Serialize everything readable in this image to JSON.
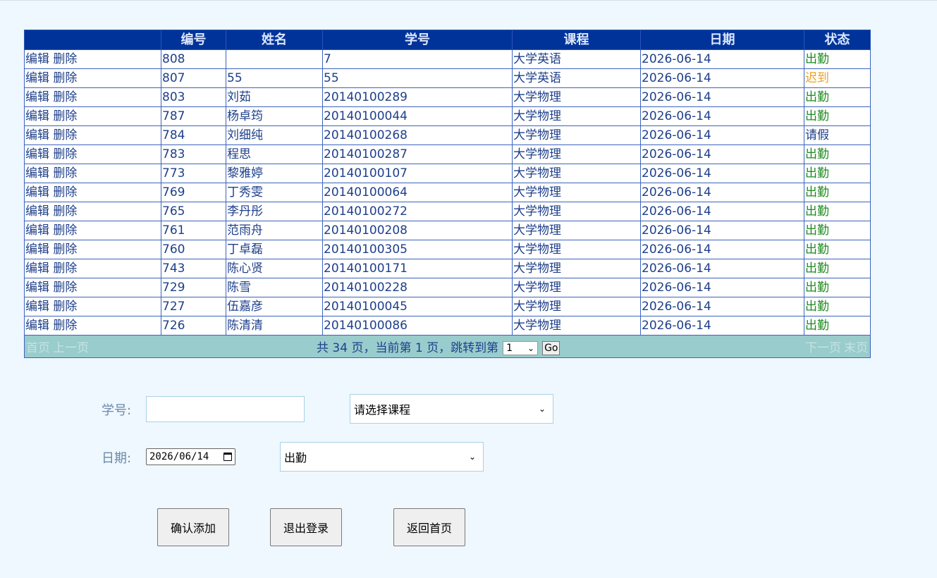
{
  "table": {
    "headers": [
      "",
      "编号",
      "姓名",
      "学号",
      "课程",
      "日期",
      "状态"
    ],
    "edit_label": "编辑",
    "delete_label": "删除",
    "rows": [
      {
        "id": "808",
        "name": "",
        "student_no": "7",
        "course": "大学英语",
        "date": "2026-06-14",
        "status": "出勤",
        "status_type": "ok"
      },
      {
        "id": "807",
        "name": "55",
        "student_no": "55",
        "course": "大学英语",
        "date": "2026-06-14",
        "status": "迟到",
        "status_type": "late"
      },
      {
        "id": "803",
        "name": "刘茹",
        "student_no": "20140100289",
        "course": "大学物理",
        "date": "2026-06-14",
        "status": "出勤",
        "status_type": "ok"
      },
      {
        "id": "787",
        "name": "杨卓筠",
        "student_no": "20140100044",
        "course": "大学物理",
        "date": "2026-06-14",
        "status": "出勤",
        "status_type": "ok"
      },
      {
        "id": "784",
        "name": "刘细纯",
        "student_no": "20140100268",
        "course": "大学物理",
        "date": "2026-06-14",
        "status": "请假",
        "status_type": "leave"
      },
      {
        "id": "783",
        "name": "程思",
        "student_no": "20140100287",
        "course": "大学物理",
        "date": "2026-06-14",
        "status": "出勤",
        "status_type": "ok"
      },
      {
        "id": "773",
        "name": "黎雅婷",
        "student_no": "20140100107",
        "course": "大学物理",
        "date": "2026-06-14",
        "status": "出勤",
        "status_type": "ok"
      },
      {
        "id": "769",
        "name": "丁秀雯",
        "student_no": "20140100064",
        "course": "大学物理",
        "date": "2026-06-14",
        "status": "出勤",
        "status_type": "ok"
      },
      {
        "id": "765",
        "name": "李丹彤",
        "student_no": "20140100272",
        "course": "大学物理",
        "date": "2026-06-14",
        "status": "出勤",
        "status_type": "ok"
      },
      {
        "id": "761",
        "name": "范雨舟",
        "student_no": "20140100208",
        "course": "大学物理",
        "date": "2026-06-14",
        "status": "出勤",
        "status_type": "ok"
      },
      {
        "id": "760",
        "name": "丁卓磊",
        "student_no": "20140100305",
        "course": "大学物理",
        "date": "2026-06-14",
        "status": "出勤",
        "status_type": "ok"
      },
      {
        "id": "743",
        "name": "陈心贤",
        "student_no": "20140100171",
        "course": "大学物理",
        "date": "2026-06-14",
        "status": "出勤",
        "status_type": "ok"
      },
      {
        "id": "729",
        "name": "陈雪",
        "student_no": "20140100228",
        "course": "大学物理",
        "date": "2026-06-14",
        "status": "出勤",
        "status_type": "ok"
      },
      {
        "id": "727",
        "name": "伍嘉彦",
        "student_no": "20140100045",
        "course": "大学物理",
        "date": "2026-06-14",
        "status": "出勤",
        "status_type": "ok"
      },
      {
        "id": "726",
        "name": "陈清清",
        "student_no": "20140100086",
        "course": "大学物理",
        "date": "2026-06-14",
        "status": "出勤",
        "status_type": "ok"
      }
    ]
  },
  "pager": {
    "first": "首页",
    "prev": "上一页",
    "info": "共 34 页，当前第 1 页，跳转到第",
    "page_select": "1",
    "go": "Go",
    "next": "下一页",
    "last": "末页"
  },
  "form": {
    "student_no_label": "学号:",
    "student_no_value": "",
    "course_select": "请选择课程",
    "date_label": "日期:",
    "date_value": "2026/06/14",
    "status_select": "出勤"
  },
  "buttons": {
    "confirm": "确认添加",
    "logout": "退出登录",
    "home": "返回首页"
  },
  "icons": {
    "dropdown": "chevron-down-icon",
    "calendar": "calendar-icon"
  },
  "colors": {
    "header_bg": "#003399",
    "pager_bg": "#99cccc",
    "status_ok": "#1f8a1f",
    "status_late": "#f0a020",
    "page_bg": "#eff7ff"
  }
}
